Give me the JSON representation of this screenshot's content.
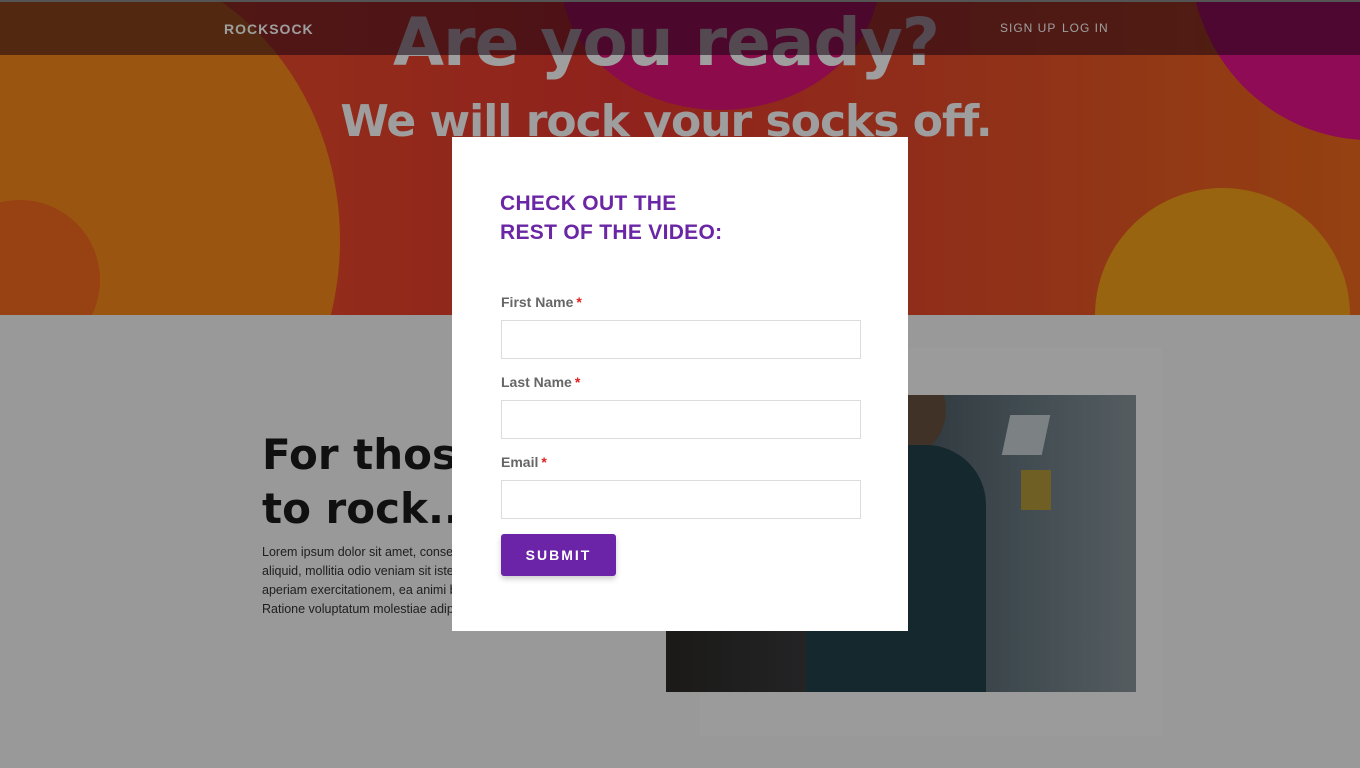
{
  "nav": {
    "brand": "ROCKSOCK",
    "links": [
      {
        "label": "SIGN UP"
      },
      {
        "label": "LOG IN"
      }
    ]
  },
  "hero": {
    "title": "Are you ready?",
    "subtitle": "We will rock your socks off."
  },
  "section": {
    "heading_line1": "For those",
    "heading_line2": "to rock...",
    "body_lines": [
      "Lorem ipsum dolor sit amet, consec",
      "aliquid, mollitia odio veniam sit iste",
      "aperiam exercitationem, ea animi b",
      "Ratione voluptatum molestiae adip"
    ]
  },
  "modal": {
    "title_line1": "CHECK OUT THE",
    "title_line2": "REST OF THE VIDEO:",
    "fields": [
      {
        "label": "First Name",
        "required_mark": "*",
        "value": ""
      },
      {
        "label": "Last Name",
        "required_mark": "*",
        "value": ""
      },
      {
        "label": "Email",
        "required_mark": "*",
        "value": ""
      }
    ],
    "submit_label": "SUBMIT"
  },
  "colors": {
    "accent_purple": "#6b24a8",
    "required_red": "#e02020",
    "hero_orange": "#ee4a2c",
    "hero_pink": "#e0137a"
  }
}
